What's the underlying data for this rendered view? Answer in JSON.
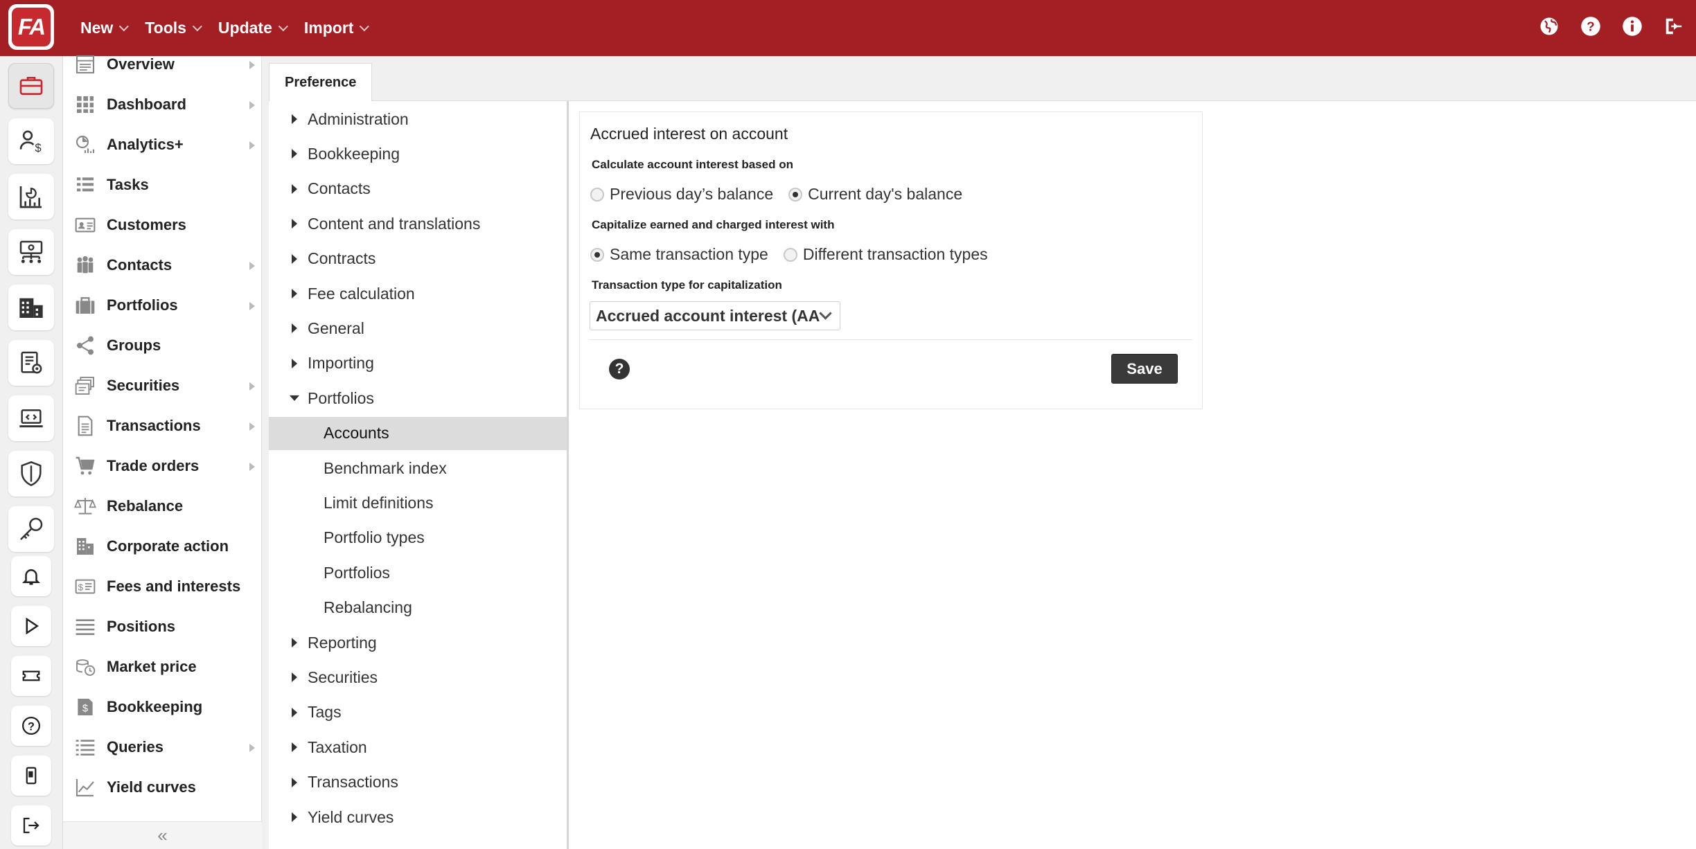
{
  "app": {
    "logo_text": "FA"
  },
  "topmenu": [
    {
      "label": "New"
    },
    {
      "label": "Tools"
    },
    {
      "label": "Update"
    },
    {
      "label": "Import"
    }
  ],
  "top_icons": [
    "globe-icon",
    "help-icon",
    "info-icon",
    "logout-icon"
  ],
  "rail_icons": [
    "briefcase-icon",
    "client-money-icon",
    "analytics-report-icon",
    "org-chart-icon",
    "building-icon",
    "settings-document-icon",
    "code-laptop-icon",
    "shield-icon",
    "key-icon",
    "bell-icon",
    "play-icon",
    "ticket-icon",
    "question-circle-icon",
    "mobile-icon",
    "sign-out-icon"
  ],
  "nav": {
    "items": [
      {
        "label": "Overview",
        "icon": "overview-icon",
        "has_submenu": true
      },
      {
        "label": "Dashboard",
        "icon": "dashboard-grid-icon",
        "has_submenu": true
      },
      {
        "label": "Analytics+",
        "icon": "analytics-icon",
        "has_submenu": true
      },
      {
        "label": "Tasks",
        "icon": "tasks-list-icon",
        "has_submenu": false
      },
      {
        "label": "Customers",
        "icon": "customer-card-icon",
        "has_submenu": false
      },
      {
        "label": "Contacts",
        "icon": "contacts-people-icon",
        "has_submenu": true
      },
      {
        "label": "Portfolios",
        "icon": "portfolio-briefcase-icon",
        "has_submenu": true
      },
      {
        "label": "Groups",
        "icon": "share-groups-icon",
        "has_submenu": false
      },
      {
        "label": "Securities",
        "icon": "securities-icon",
        "has_submenu": true
      },
      {
        "label": "Transactions",
        "icon": "transactions-document-icon",
        "has_submenu": true
      },
      {
        "label": "Trade orders",
        "icon": "cart-icon",
        "has_submenu": true
      },
      {
        "label": "Rebalance",
        "icon": "scale-icon",
        "has_submenu": false
      },
      {
        "label": "Corporate action",
        "icon": "corporate-building-icon",
        "has_submenu": false
      },
      {
        "label": "Fees and interests",
        "icon": "fees-icon",
        "has_submenu": false
      },
      {
        "label": "Positions",
        "icon": "positions-lines-icon",
        "has_submenu": false
      },
      {
        "label": "Market price",
        "icon": "market-price-icon",
        "has_submenu": false
      },
      {
        "label": "Bookkeeping",
        "icon": "bookkeeping-icon",
        "has_submenu": false
      },
      {
        "label": "Queries",
        "icon": "queries-list-icon",
        "has_submenu": true
      },
      {
        "label": "Yield curves",
        "icon": "yield-curve-icon",
        "has_submenu": false
      }
    ],
    "collapse_label": "«"
  },
  "tabs": [
    {
      "label": "Preference"
    }
  ],
  "tree": [
    {
      "label": "Administration",
      "level": 0,
      "expanded": false
    },
    {
      "label": "Bookkeeping",
      "level": 0,
      "expanded": false
    },
    {
      "label": "Contacts",
      "level": 0,
      "expanded": false
    },
    {
      "label": "Content and translations",
      "level": 0,
      "expanded": false
    },
    {
      "label": "Contracts",
      "level": 0,
      "expanded": false
    },
    {
      "label": "Fee calculation",
      "level": 0,
      "expanded": false
    },
    {
      "label": "General",
      "level": 0,
      "expanded": false
    },
    {
      "label": "Importing",
      "level": 0,
      "expanded": false
    },
    {
      "label": "Portfolios",
      "level": 0,
      "expanded": true
    },
    {
      "label": "Accounts",
      "level": 1,
      "selected": true
    },
    {
      "label": "Benchmark index",
      "level": 1
    },
    {
      "label": "Limit definitions",
      "level": 1
    },
    {
      "label": "Portfolio types",
      "level": 1
    },
    {
      "label": "Portfolios",
      "level": 1
    },
    {
      "label": "Rebalancing",
      "level": 1
    },
    {
      "label": "Reporting",
      "level": 0,
      "expanded": false
    },
    {
      "label": "Securities",
      "level": 0,
      "expanded": false
    },
    {
      "label": "Tags",
      "level": 0,
      "expanded": false
    },
    {
      "label": "Taxation",
      "level": 0,
      "expanded": false
    },
    {
      "label": "Transactions",
      "level": 0,
      "expanded": false
    },
    {
      "label": "Yield curves",
      "level": 0,
      "expanded": false
    }
  ],
  "form": {
    "title": "Accrued interest on account",
    "interest_basis": {
      "label": "Calculate account interest based on",
      "options": [
        {
          "label": "Previous day’s balance",
          "checked": false
        },
        {
          "label": "Current day's balance",
          "checked": true
        }
      ]
    },
    "capitalize": {
      "label": "Capitalize earned and charged interest with",
      "options": [
        {
          "label": "Same transaction type",
          "checked": true
        },
        {
          "label": "Different transaction types",
          "checked": false
        }
      ]
    },
    "tx_type": {
      "label": "Transaction type for capitalization",
      "value": "Accrued account interest (AA"
    },
    "save_label": "Save",
    "help_label": "?"
  },
  "colors": {
    "brand": "#a31f24",
    "save_button": "#3a3a3a"
  }
}
